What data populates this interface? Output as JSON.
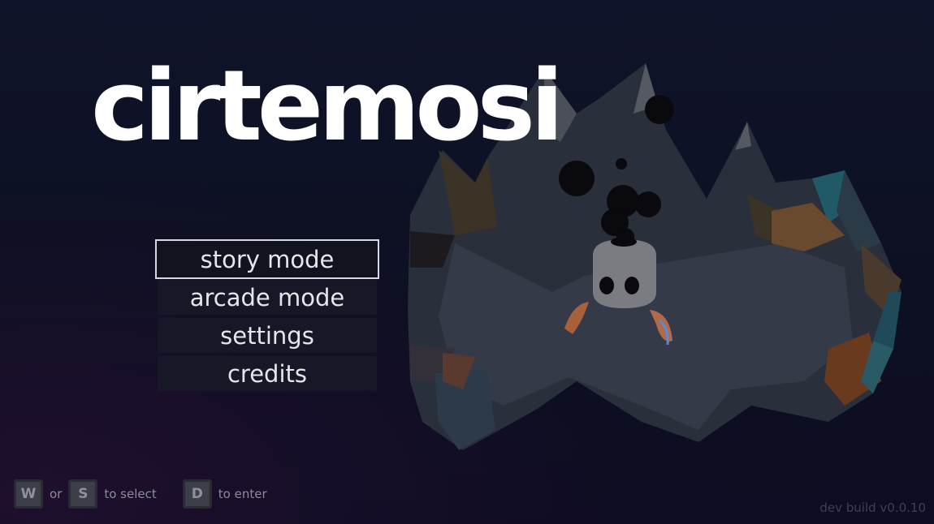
{
  "game_title": "cirtemosi",
  "menu": {
    "items": [
      {
        "label": "story mode",
        "selected": true
      },
      {
        "label": "arcade mode",
        "selected": false
      },
      {
        "label": "settings",
        "selected": false
      },
      {
        "label": "credits",
        "selected": false
      }
    ]
  },
  "controls": {
    "select_key_1": "W",
    "or_text": "or",
    "select_key_2": "S",
    "select_text": "to select",
    "enter_key": "D",
    "enter_text": "to enter"
  },
  "build_version": "dev build v0.0.10",
  "colors": {
    "background": "#0d1022",
    "title": "#ffffff",
    "menu_item_bg": "#181a28",
    "selected_outline": "#d8d8e0"
  }
}
